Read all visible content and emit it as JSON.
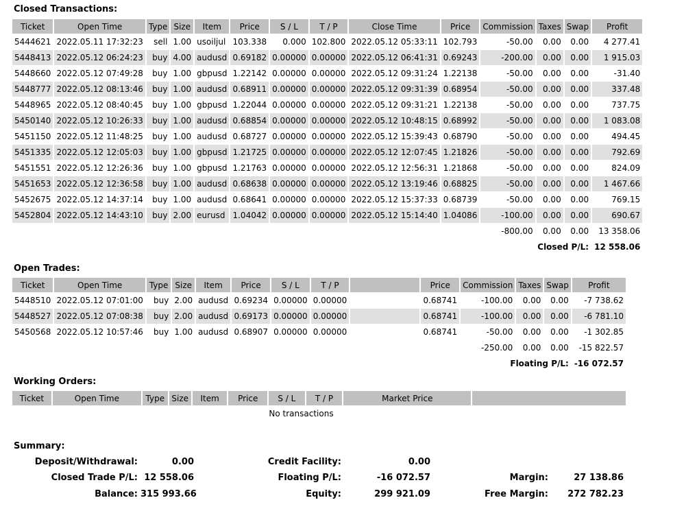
{
  "closed": {
    "title": "Closed Transactions:",
    "headers": [
      "Ticket",
      "Open Time",
      "Type",
      "Size",
      "Item",
      "Price",
      "S / L",
      "T / P",
      "Close Time",
      "Price",
      "Commission",
      "Taxes",
      "Swap",
      "Profit"
    ],
    "rows": [
      [
        "5444621",
        "2022.05.11 17:32:23",
        "sell",
        "1.00",
        "usoiljul",
        "103.338",
        "0.000",
        "102.800",
        "2022.05.12 05:33:11",
        "102.793",
        "-50.00",
        "0.00",
        "0.00",
        "4 277.41"
      ],
      [
        "5448413",
        "2022.05.12 06:24:23",
        "buy",
        "4.00",
        "audusd",
        "0.69182",
        "0.00000",
        "0.00000",
        "2022.05.12 06:41:31",
        "0.69243",
        "-200.00",
        "0.00",
        "0.00",
        "1 915.03"
      ],
      [
        "5448660",
        "2022.05.12 07:49:28",
        "buy",
        "1.00",
        "gbpusd",
        "1.22142",
        "0.00000",
        "0.00000",
        "2022.05.12 09:31:24",
        "1.22138",
        "-50.00",
        "0.00",
        "0.00",
        "-31.40"
      ],
      [
        "5448777",
        "2022.05.12 08:13:46",
        "buy",
        "1.00",
        "audusd",
        "0.68911",
        "0.00000",
        "0.00000",
        "2022.05.12 09:31:39",
        "0.68954",
        "-50.00",
        "0.00",
        "0.00",
        "337.48"
      ],
      [
        "5448965",
        "2022.05.12 08:40:45",
        "buy",
        "1.00",
        "gbpusd",
        "1.22044",
        "0.00000",
        "0.00000",
        "2022.05.12 09:31:21",
        "1.22138",
        "-50.00",
        "0.00",
        "0.00",
        "737.75"
      ],
      [
        "5450140",
        "2022.05.12 10:26:33",
        "buy",
        "1.00",
        "audusd",
        "0.68854",
        "0.00000",
        "0.00000",
        "2022.05.12 10:48:15",
        "0.68992",
        "-50.00",
        "0.00",
        "0.00",
        "1 083.08"
      ],
      [
        "5451150",
        "2022.05.12 11:48:25",
        "buy",
        "1.00",
        "audusd",
        "0.68727",
        "0.00000",
        "0.00000",
        "2022.05.12 15:39:43",
        "0.68790",
        "-50.00",
        "0.00",
        "0.00",
        "494.45"
      ],
      [
        "5451335",
        "2022.05.12 12:05:03",
        "buy",
        "1.00",
        "gbpusd",
        "1.21725",
        "0.00000",
        "0.00000",
        "2022.05.12 12:07:45",
        "1.21826",
        "-50.00",
        "0.00",
        "0.00",
        "792.69"
      ],
      [
        "5451551",
        "2022.05.12 12:26:36",
        "buy",
        "1.00",
        "gbpusd",
        "1.21763",
        "0.00000",
        "0.00000",
        "2022.05.12 12:56:31",
        "1.21868",
        "-50.00",
        "0.00",
        "0.00",
        "824.09"
      ],
      [
        "5451653",
        "2022.05.12 12:36:58",
        "buy",
        "1.00",
        "audusd",
        "0.68638",
        "0.00000",
        "0.00000",
        "2022.05.12 13:19:46",
        "0.68825",
        "-50.00",
        "0.00",
        "0.00",
        "1 467.66"
      ],
      [
        "5452675",
        "2022.05.12 14:37:14",
        "buy",
        "1.00",
        "audusd",
        "0.68641",
        "0.00000",
        "0.00000",
        "2022.05.12 15:37:33",
        "0.68739",
        "-50.00",
        "0.00",
        "0.00",
        "769.15"
      ],
      [
        "5452804",
        "2022.05.12 14:43:10",
        "buy",
        "2.00",
        "eurusd",
        "1.04042",
        "0.00000",
        "0.00000",
        "2022.05.12 15:14:40",
        "1.04086",
        "-100.00",
        "0.00",
        "0.00",
        "690.67"
      ]
    ],
    "totals": {
      "commission": "-800.00",
      "taxes": "0.00",
      "swap": "0.00",
      "profit": "13 358.06"
    },
    "pl_label": "Closed P/L:",
    "pl_value": "12 558.06"
  },
  "open": {
    "title": "Open Trades:",
    "headers": [
      "Ticket",
      "Open Time",
      "Type",
      "Size",
      "Item",
      "Price",
      "S / L",
      "T / P",
      "",
      "Price",
      "Commission",
      "Taxes",
      "Swap",
      "Profit"
    ],
    "rows": [
      [
        "5448510",
        "2022.05.12 07:01:00",
        "buy",
        "2.00",
        "audusd",
        "0.69234",
        "0.00000",
        "0.00000",
        "",
        "0.68741",
        "-100.00",
        "0.00",
        "0.00",
        "-7 738.62"
      ],
      [
        "5448527",
        "2022.05.12 07:08:38",
        "buy",
        "2.00",
        "audusd",
        "0.69173",
        "0.00000",
        "0.00000",
        "",
        "0.68741",
        "-100.00",
        "0.00",
        "0.00",
        "-6 781.10"
      ],
      [
        "5450568",
        "2022.05.12 10:57:46",
        "buy",
        "1.00",
        "audusd",
        "0.68907",
        "0.00000",
        "0.00000",
        "",
        "0.68741",
        "-50.00",
        "0.00",
        "0.00",
        "-1 302.85"
      ]
    ],
    "totals": {
      "commission": "-250.00",
      "taxes": "0.00",
      "swap": "0.00",
      "profit": "-15 822.57"
    },
    "pl_label": "Floating P/L:",
    "pl_value": "-16 072.57"
  },
  "working": {
    "title": "Working Orders:",
    "headers": [
      "Ticket",
      "Open Time",
      "Type",
      "Size",
      "Item",
      "Price",
      "S / L",
      "T / P",
      "Market Price",
      ""
    ],
    "empty_text": "No transactions"
  },
  "summary": {
    "title": "Summary:",
    "deposit_label": "Deposit/Withdrawal:",
    "deposit_value": "0.00",
    "closed_pl_label": "Closed Trade P/L:",
    "closed_pl_value": "12 558.06",
    "balance_label": "Balance:",
    "balance_value": "315 993.66",
    "credit_label": "Credit Facility:",
    "credit_value": "0.00",
    "floating_label": "Floating P/L:",
    "floating_value": "-16 072.57",
    "equity_label": "Equity:",
    "equity_value": "299 921.09",
    "margin_label": "Margin:",
    "margin_value": "27 138.86",
    "free_margin_label": "Free Margin:",
    "free_margin_value": "272 782.23"
  }
}
